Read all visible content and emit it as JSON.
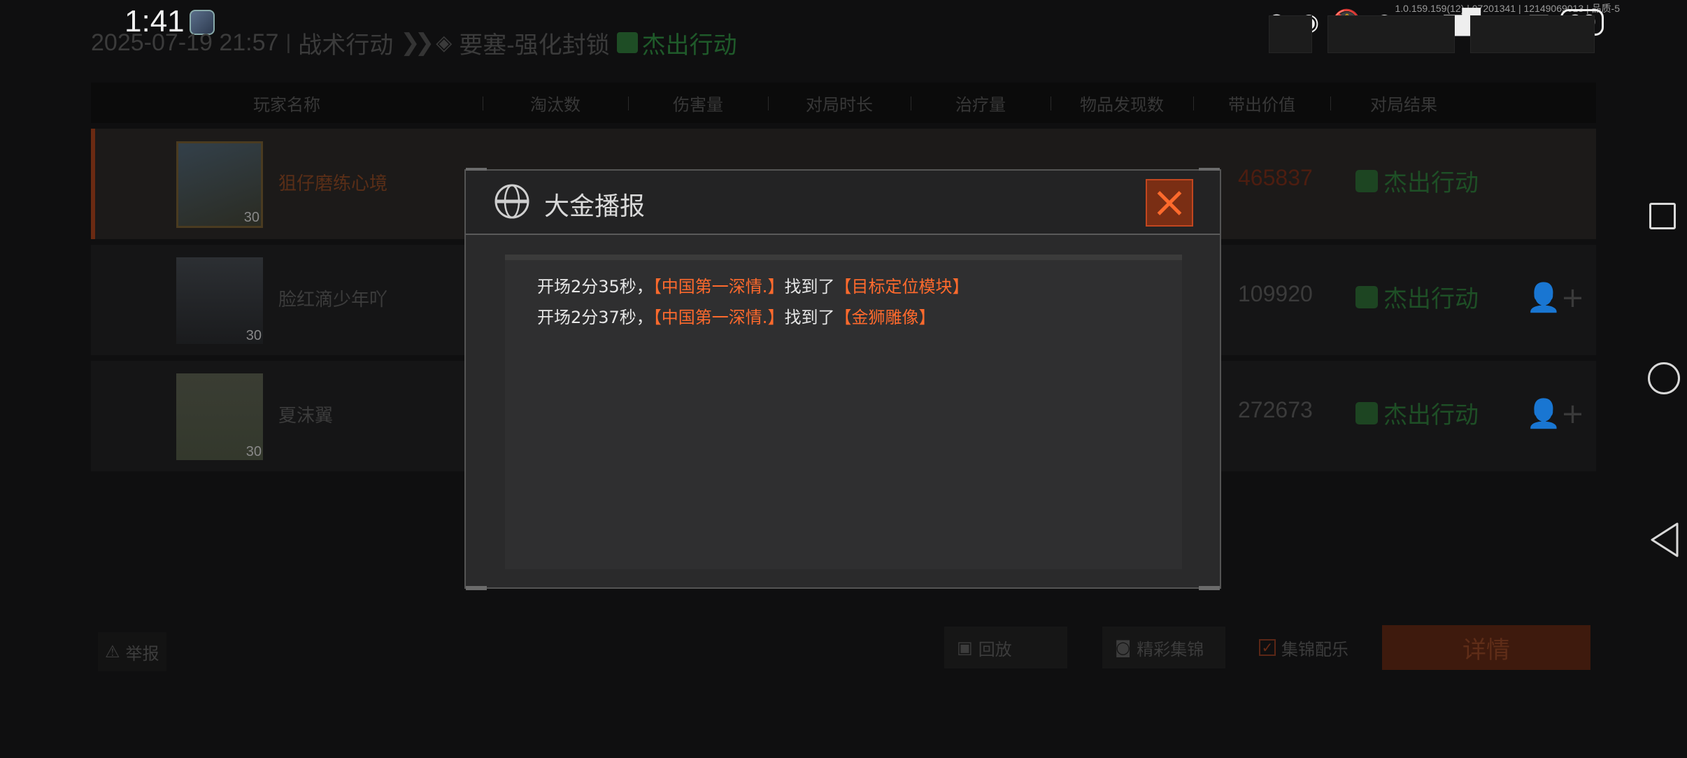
{
  "status_bar": {
    "time": "1:41",
    "battery": "90",
    "debug": "1.0.159.159(12) | 07201341 | 12149069013 | 品质-5"
  },
  "header": {
    "datetime": "2025-07-19 21:57",
    "mode": "战术行动",
    "map": "要塞-强化封锁",
    "result": "杰出行动"
  },
  "table": {
    "columns": [
      "玩家名称",
      "淘汰数",
      "伤害量",
      "对局时长",
      "治疗量",
      "物品发现数",
      "带出价值",
      "对局结果"
    ],
    "rows": [
      {
        "name": "狙仔磨练心境",
        "level": "30",
        "value": "465837",
        "result": "杰出行动"
      },
      {
        "name": "脸红滴少年吖",
        "level": "30",
        "value": "109920",
        "result": "杰出行动"
      },
      {
        "name": "夏沫翼",
        "level": "30",
        "value": "272673",
        "result": "杰出行动"
      }
    ]
  },
  "bottom": {
    "report": "举报",
    "replay": "回放",
    "highlights": "精彩集锦",
    "music": "集锦配乐",
    "details": "详情"
  },
  "modal": {
    "title": "大金播报",
    "messages": [
      {
        "prefix": "开场2分35秒，",
        "player": "【中国第一深情.】",
        "verb": "找到了",
        "item": "【目标定位模块】"
      },
      {
        "prefix": "开场2分37秒，",
        "player": "【中国第一深情.】",
        "verb": "找到了",
        "item": "【金狮雕像】"
      }
    ]
  },
  "colors": {
    "accent_orange": "#ff6a2d",
    "success_green": "#1e4f26"
  }
}
